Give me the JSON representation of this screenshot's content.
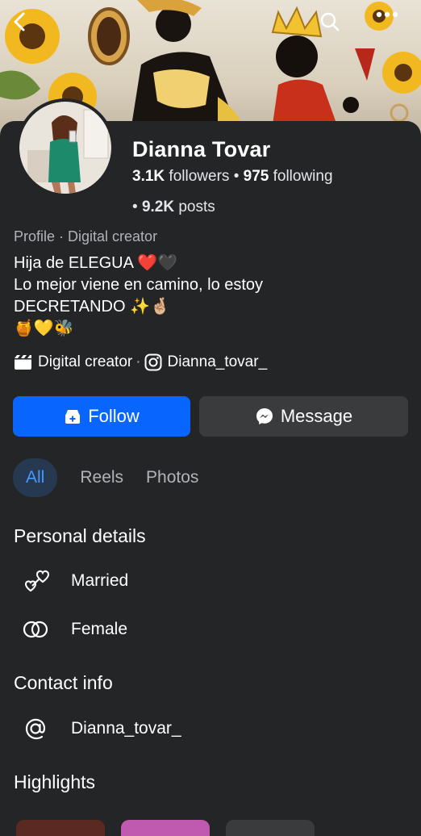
{
  "profile": {
    "name": "Dianna Tovar",
    "followers": "3.1K",
    "followers_label": "followers",
    "following": "975",
    "following_label": "following",
    "posts": "9.2K",
    "posts_label": "posts",
    "category_line": "Profile · Digital creator",
    "bio_lines": [
      "Hija de ELEGUA ❤️🖤",
      "Lo mejor viene en camino, lo estoy",
      "DECRETANDO ✨🤞🏼",
      "🍯💛🐝"
    ],
    "link_category": "Digital creator",
    "link_separator": "·",
    "instagram_handle": "Dianna_tovar_"
  },
  "actions": {
    "follow_label": "Follow",
    "message_label": "Message"
  },
  "tabs": [
    {
      "label": "All",
      "active": true
    },
    {
      "label": "Reels",
      "active": false
    },
    {
      "label": "Photos",
      "active": false
    }
  ],
  "personal_details": {
    "title": "Personal details",
    "items": [
      {
        "icon": "hearts-icon",
        "label": "Married"
      },
      {
        "icon": "gender-rings-icon",
        "label": "Female"
      }
    ]
  },
  "contact_info": {
    "title": "Contact info",
    "items": [
      {
        "icon": "at-sign-icon",
        "label": "Dianna_tovar_"
      }
    ]
  },
  "highlights": {
    "title": "Highlights"
  },
  "colors": {
    "background": "#242526",
    "primary_button": "#0866ff",
    "secondary_button": "#3a3b3c",
    "active_tab_bg": "#263951",
    "active_tab_text": "#4599ff"
  }
}
